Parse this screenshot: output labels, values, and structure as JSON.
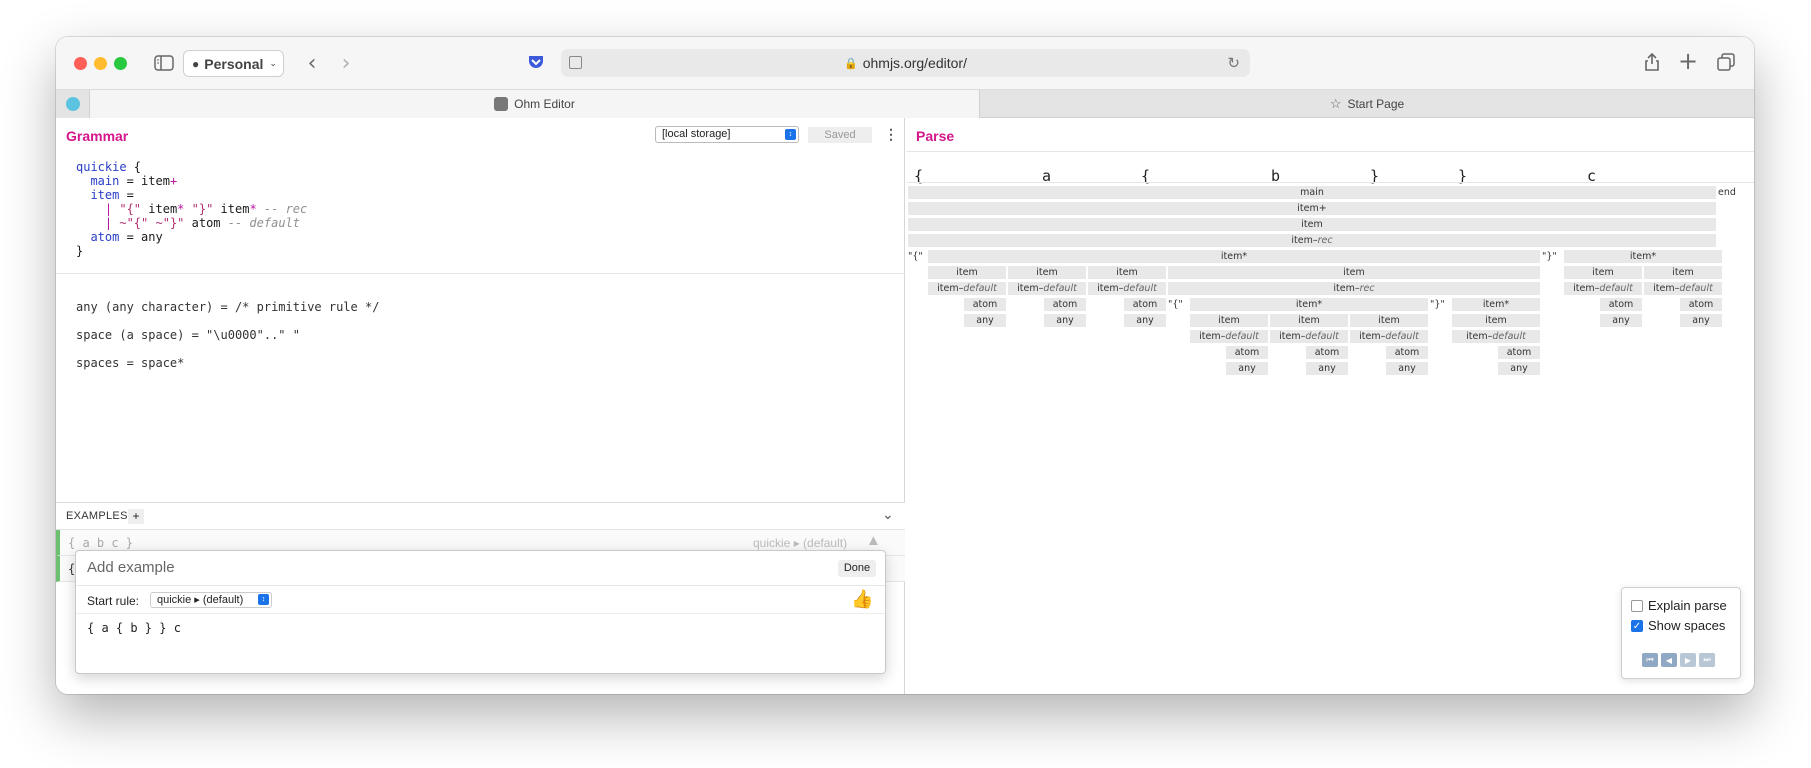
{
  "browser": {
    "profile_label": "Personal",
    "url": "ohmjs.org/editor/",
    "tabs": [
      {
        "label": "Ohm Editor"
      },
      {
        "label": "Start Page"
      }
    ]
  },
  "grammar": {
    "title": "Grammar",
    "storage_select": "[local storage]",
    "saved_label": "Saved",
    "source": {
      "l1_name": "quickie",
      "l1_brace": " {",
      "l2_rule": "main",
      "l2_eq": " = ",
      "l2_item": "item",
      "l2_plus": "+",
      "l3_rule": "item",
      "l3_eq": " =",
      "l4_bar": "| ",
      "l4_s1": "\"{\"",
      "l4_item": " item",
      "l4_star": "*",
      "l4_s2": " \"}\"",
      "l4_item2": " item",
      "l4_star2": "*",
      "l4_case": " -- rec",
      "l5_bar": "| ",
      "l5_s1": "~\"{\"",
      "l5_s2": " ~\"}\"",
      "l5_atom": " atom",
      "l5_case": " -- default",
      "l6_rule": "atom",
      "l6_eq": " = ",
      "l6_any": "any",
      "l7_close": "}"
    },
    "builtins": [
      "any (any character) = /* primitive rule */",
      "space (a space) = \"\\u0000\"..\" \"",
      "spaces = space*"
    ]
  },
  "examples": {
    "header": "EXAMPLES",
    "add_icon": "+",
    "collapse_icon": "chevron-down-icon",
    "rows": [
      {
        "text": "{ a b c }",
        "rule": "quickie ▸ (default)"
      },
      {
        "text": "{"
      }
    ]
  },
  "add_example": {
    "title": "Add example",
    "done_label": "Done",
    "start_rule_label": "Start rule:",
    "start_rule_value": "quickie ▸ (default)",
    "input": "{ a { b } } c",
    "thumb": "👍"
  },
  "parse": {
    "title": "Parse",
    "input_chars": [
      "{",
      "a",
      "{",
      "b",
      "}",
      "}",
      "c"
    ],
    "tree": {
      "main": "main",
      "end": "end",
      "item_plus": "item+",
      "item": "item",
      "item_rec": "item",
      "rec": "rec",
      "default": "default",
      "lbrace": "\"{\"",
      "rbrace": "\"}\"",
      "item_star": "item*",
      "atom": "atom",
      "any": "any",
      "dash": " – "
    },
    "explain_label": "Explain parse",
    "show_spaces_label": "Show spaces",
    "explain_checked": false,
    "show_spaces_checked": true
  }
}
